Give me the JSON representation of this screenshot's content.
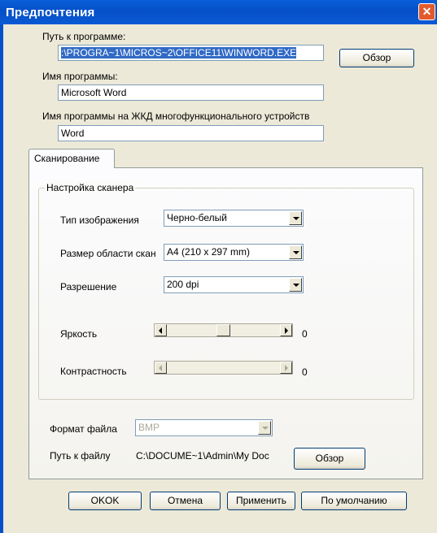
{
  "window": {
    "title": "Предпочтения",
    "close_glyph": "✕"
  },
  "program_path": {
    "label": "Путь к программе:",
    "value": ":\\PROGRA~1\\MICROS~2\\OFFICE11\\WINWORD.EXE",
    "browse": "Обзор"
  },
  "program_name": {
    "label": "Имя программы:",
    "value": "Microsoft Word"
  },
  "mfp_name": {
    "label": "Имя программы на ЖКД многофункционального устройств",
    "value": "Word"
  },
  "tab": {
    "label": "Сканирование"
  },
  "scanner": {
    "group_title": "Настройка сканера",
    "image_type": {
      "label": "Тип изображения",
      "value": "Черно-белый"
    },
    "area_size": {
      "label": "Размер области скан",
      "value": "A4 (210 x 297 mm)"
    },
    "resolution": {
      "label": "Разрешение",
      "value": "200 dpi"
    },
    "brightness": {
      "label": "Яркость",
      "value": "0",
      "level": 0.5
    },
    "contrast": {
      "label": "Контрастность",
      "value": "0",
      "enabled": false
    }
  },
  "file_format": {
    "label": "Формат файла",
    "value": "BMP"
  },
  "file_path": {
    "label": "Путь к файлу",
    "value": "C:\\DOCUME~1\\Admin\\My Doc",
    "browse": "Обзор"
  },
  "buttons": {
    "ok": "OKOK",
    "cancel": "Отмена",
    "apply": "Применить",
    "defaults": "По умолчанию"
  },
  "colors": {
    "titlebar": "#0550c8",
    "selection": "#316ac5",
    "dialog": "#ece9d8"
  }
}
